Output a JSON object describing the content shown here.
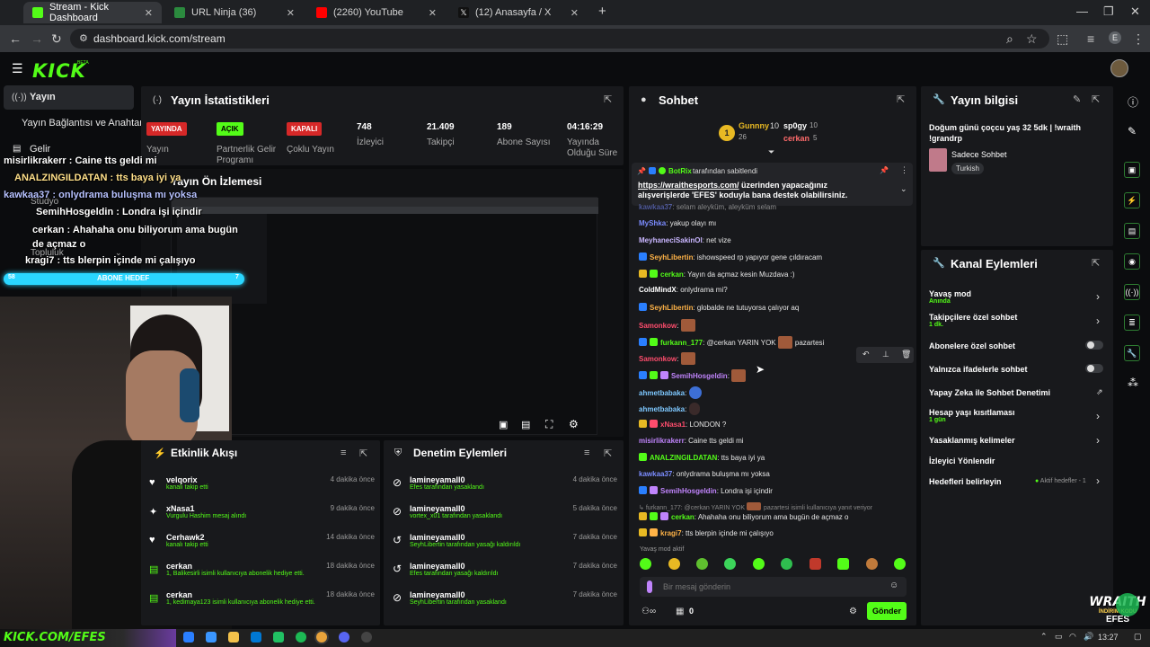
{
  "browser": {
    "tabs": [
      {
        "label": "Stream - Kick Dashboard",
        "color": "#53fc18"
      },
      {
        "label": "URL Ninja (36)",
        "color": "#2b8a3e"
      },
      {
        "label": "(2260) YouTube",
        "color": "#ff0000"
      },
      {
        "label": "(12) Anasayfa / X",
        "color": "#222222"
      }
    ],
    "new_tab": "+",
    "url": "dashboard.kick.com/stream",
    "profile": "E"
  },
  "app": {
    "logo": "KICK",
    "logo_beta": "BETA"
  },
  "sidebar": {
    "items": [
      {
        "label": "Yayın",
        "icon": "broadcast-icon"
      },
      {
        "label": "Yayın Bağlantısı ve Anahtarı"
      },
      {
        "label": "Gelir",
        "icon": "money-icon"
      },
      {
        "label": "Stüdyo"
      },
      {
        "label": "Topluluk"
      }
    ]
  },
  "stats": {
    "title": "Yayın İstatistikleri",
    "items": [
      {
        "badge": "YAYINDA",
        "label": "Yayın"
      },
      {
        "badge": "AÇIK",
        "label": "Partnerlik Gelir Programı"
      },
      {
        "badge": "KAPALI",
        "label": "Çoklu Yayın"
      },
      {
        "value": "748",
        "label": "İzleyici"
      },
      {
        "value": "21.409",
        "label": "Takipçi"
      },
      {
        "value": "189",
        "label": "Abone Sayısı"
      },
      {
        "value": "04:16:29",
        "label": "Yayında Olduğu Süre"
      }
    ]
  },
  "preview": {
    "title": "Yayın Ön İzlemesi"
  },
  "stream_overlay": {
    "lines": [
      "misirlikrakerr : Caine tts geldi mi",
      "ANALZINGILDATAN : tts baya iyi ya",
      "kawkaa37 : onlydrama buluşma mı yoksa",
      "SemihHosgeldin : Londra işi içindir",
      "cerkan : Ahahaha onu biliyorum ama bugün de açmaz o",
      "kragi7 : tts blerpin içinde mi çalışıyo"
    ],
    "sub_bar": "ABONE HEDEF",
    "sub_count": "58",
    "sub_goal": "7",
    "bottom_text": "KICK.COM/EFES",
    "wraith": "WRAITH",
    "wraith_sub": "İNDİRİM KODU",
    "wraith_code": "EFES"
  },
  "chat": {
    "title": "Sohbet",
    "leaderboard": [
      {
        "name": "Gunnny",
        "count": "10",
        "sub": "26"
      },
      {
        "name": "sp0gy",
        "count": "10"
      },
      {
        "name": "cerkan",
        "count": "5"
      }
    ],
    "rank": "1",
    "pinned_by": "BotRix",
    "pinned_label": "tarafından sabitlendi",
    "pinned_link": "https://wraithesports.com/",
    "pinned_text": "üzerinden yapacağınız alışverişlerde 'EFES' koduyla bana destek olabilirsiniz.",
    "messages": [
      {
        "user": "kawkaa37",
        "text": "selam aleyküm, aleyküm selam",
        "color": "#7b8cff"
      },
      {
        "user": "MyShka",
        "text": "yakup olayı mı",
        "color": "#7b8cff"
      },
      {
        "user": "MeyhaneciSakinOl",
        "text": "net vize",
        "color": "#c9b6ff"
      },
      {
        "user": "SeyhLibertin",
        "text": "ishowspeed rp yapıyor gene çıldıracam",
        "color": "#ffb347"
      },
      {
        "user": "cerkan",
        "text": "Yayın da açmaz kesin Muzdava :)",
        "color": "#53fc18"
      },
      {
        "user": "ColdMindX",
        "text": "onlydrama mi?",
        "color": "#ffffff"
      },
      {
        "user": "SeyhLibertin",
        "text": "globalde ne tutuyorsa çalıyor aq",
        "color": "#ffb347"
      },
      {
        "user": "Samonkow",
        "text": "",
        "color": "#ff4d6d"
      },
      {
        "user": "furkann_177",
        "text": "@cerkan YARIN YOK",
        "extra": "pazartesi",
        "color": "#53fc18"
      },
      {
        "user": "Samonkow",
        "text": "",
        "color": "#ff4d6d"
      },
      {
        "user": "SemihHosgeldin",
        "text": "",
        "color": "#c084fc"
      },
      {
        "user": "ahmetbabaka",
        "text": "",
        "color": "#7ec8ff"
      },
      {
        "user": "ahmetbabaka",
        "text": "",
        "color": "#7ec8ff"
      },
      {
        "user": "xNasa1",
        "text": "LONDON ?",
        "color": "#ff4d6d"
      },
      {
        "user": "misirlikrakerr",
        "text": "Caine tts geldi mi",
        "color": "#c084fc"
      },
      {
        "user": "ANALZINGILDATAN",
        "text": "tts baya iyi ya",
        "color": "#53fc18"
      },
      {
        "user": "kawkaa37",
        "text": "onlydrama buluşma mı yoksa",
        "color": "#7b8cff"
      },
      {
        "user": "SemihHosgeldin",
        "text": "Londra işi içindir",
        "color": "#c084fc"
      },
      {
        "reply": "furkann_177: @cerkan YARIN YOK",
        "reply_tail": "pazartesi isimli kullanıcıya yanıt veriyor"
      },
      {
        "user": "cerkan",
        "text": "Ahahaha onu biliyorum ama bugün de açmaz o",
        "color": "#53fc18"
      },
      {
        "user": "kragi7",
        "text": "tts blerpin içinde mi çalışıyo",
        "color": "#ffb347"
      }
    ],
    "slow_mode_notice": "Yavaş mod aktif",
    "input_placeholder": "Bir mesaj gönderin",
    "points": "0",
    "send_label": "Gönder"
  },
  "stream_info": {
    "title": "Yayın bilgisi",
    "stream_title": "Doğum günü çoçcu yaş 32 5dk | !wraith !grandrp",
    "category": "Sadece Sohbet",
    "language": "Turkish"
  },
  "channel_actions": {
    "title": "Kanal Eylemleri",
    "items": [
      {
        "label": "Yavaş mod",
        "sub": "Anında",
        "control": "chevron"
      },
      {
        "label": "Takipçilere özel sohbet",
        "sub": "1 dk.",
        "control": "chevron"
      },
      {
        "label": "Abonelere özel sohbet",
        "control": "toggle"
      },
      {
        "label": "Yalnızca ifadelerle sohbet",
        "control": "toggle"
      },
      {
        "label": "Yapay Zeka ile Sohbet Denetimi",
        "control": "external"
      },
      {
        "label": "Hesap yaşı kısıtlaması",
        "sub": "1 gün",
        "control": "chevron"
      },
      {
        "label": "Yasaklanmış kelimeler",
        "control": "chevron"
      },
      {
        "label": "İzleyici Yönlendir",
        "control": "none"
      },
      {
        "label": "Hedefleri belirleyin",
        "tail": "Aktif hedefler - 1",
        "control": "chevron"
      }
    ]
  },
  "activity": {
    "title": "Etkinlik Akışı",
    "items": [
      {
        "name": "velqorix",
        "desc": "kanalı takip etti",
        "time": "4 dakika önce",
        "icon": "heart-icon"
      },
      {
        "name": "xNasa1",
        "desc": "Vurgulu Hashim mesaj alındı",
        "time": "9 dakika önce",
        "icon": "highlight-icon"
      },
      {
        "name": "Cerhawk2",
        "desc": "kanalı takip etti",
        "time": "14 dakika önce",
        "icon": "heart-icon"
      },
      {
        "name": "cerkan",
        "desc": "1, Balikesirli isimli kullanıcıya abonelik hediye etti.",
        "time": "18 dakika önce",
        "icon": "gift-icon"
      },
      {
        "name": "cerkan",
        "desc": "1, kedimaya123 isimli kullanıcıya abonelik hediye etti.",
        "time": "18 dakika önce",
        "icon": "gift-icon"
      }
    ]
  },
  "moderation": {
    "title": "Denetim Eylemleri",
    "items": [
      {
        "name": "lamineyamall0",
        "desc": "Efes tarafından yasaklandı",
        "time": "4 dakika önce",
        "icon": "ban-icon"
      },
      {
        "name": "lamineyamall0",
        "desc": "vortex_x01 tarafından yasaklandı",
        "time": "5 dakika önce",
        "icon": "ban-icon"
      },
      {
        "name": "lamineyamall0",
        "desc": "SeyhLibertin tarafından yasağı kaldırıldı",
        "time": "7 dakika önce",
        "icon": "unban-icon"
      },
      {
        "name": "lamineyamall0",
        "desc": "Efes tarafından yasağı kaldırıldı",
        "time": "7 dakika önce",
        "icon": "unban-icon"
      },
      {
        "name": "lamineyamall0",
        "desc": "SeyhLibertin tarafından yasaklandı",
        "time": "7 dakika önce",
        "icon": "ban-icon"
      }
    ]
  },
  "taskbar": {
    "time": "13:27"
  }
}
